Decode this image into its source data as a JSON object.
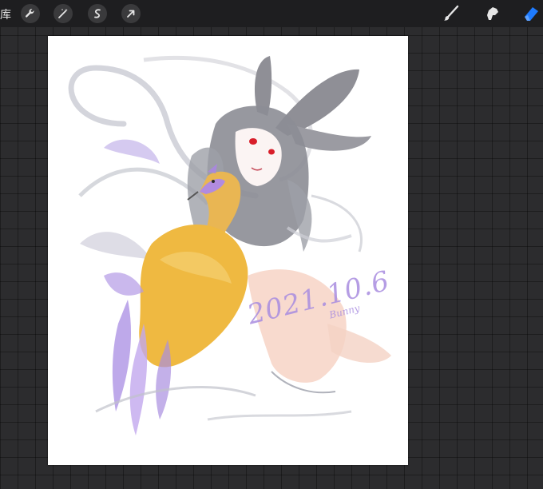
{
  "toolbar": {
    "gallery_label": "库",
    "left_tools": [
      {
        "name": "wrench-icon",
        "label": "actions"
      },
      {
        "name": "magic-wand-icon",
        "label": "adjustments"
      },
      {
        "name": "selection-icon",
        "label": "selection"
      },
      {
        "name": "arrow-cursor-icon",
        "label": "transform"
      }
    ],
    "right_tools": [
      {
        "name": "brush-icon",
        "active": false
      },
      {
        "name": "smudge-icon",
        "active": false
      },
      {
        "name": "eraser-icon",
        "active": true
      }
    ],
    "active_color": "#1e7bff"
  },
  "artwork": {
    "signature_main": "2021.10.6",
    "signature_small": "Bunny"
  }
}
